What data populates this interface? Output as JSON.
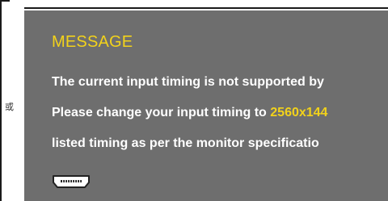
{
  "side": {
    "char": "或"
  },
  "osd": {
    "title": "MESSAGE",
    "line1": "The current input timing is not supported by",
    "line2_prefix": "Please change your input timing to ",
    "line2_highlight": "2560x144",
    "line3": "listed timing as per the monitor specificatio",
    "icon": "hdmi-port-icon"
  },
  "colors": {
    "panel_background": "#6e6e6e",
    "title": "#f2d21b",
    "highlight": "#f2d21b",
    "body_text": "#ffffff"
  }
}
